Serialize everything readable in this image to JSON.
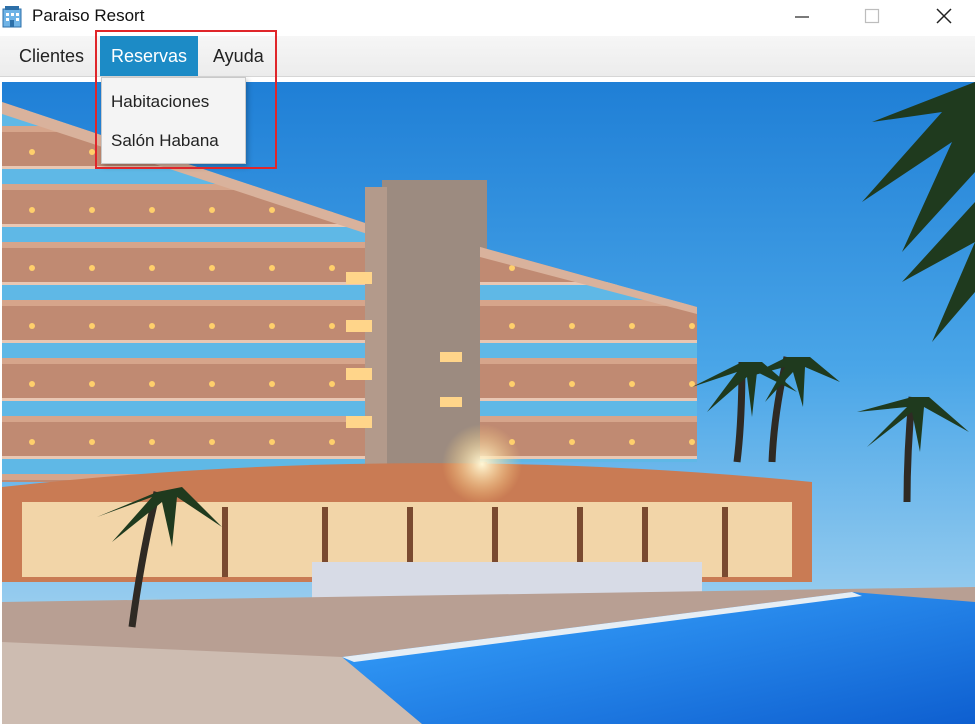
{
  "window": {
    "title": "Paraiso Resort",
    "app_icon": "hotel-icon",
    "controls": [
      "minimize-icon",
      "maximize-icon",
      "close-icon"
    ]
  },
  "menubar": {
    "items": [
      {
        "label": "Clientes"
      },
      {
        "label": "Reservas",
        "state": "open"
      },
      {
        "label": "Ayuda"
      }
    ],
    "open_menu": {
      "parent": "Reservas",
      "items": [
        {
          "label": "Habitaciones"
        },
        {
          "label": "Salón Habana"
        }
      ]
    }
  },
  "colors": {
    "menu_highlight": "#1c8bc6",
    "annotation_border": "#e0262a"
  }
}
